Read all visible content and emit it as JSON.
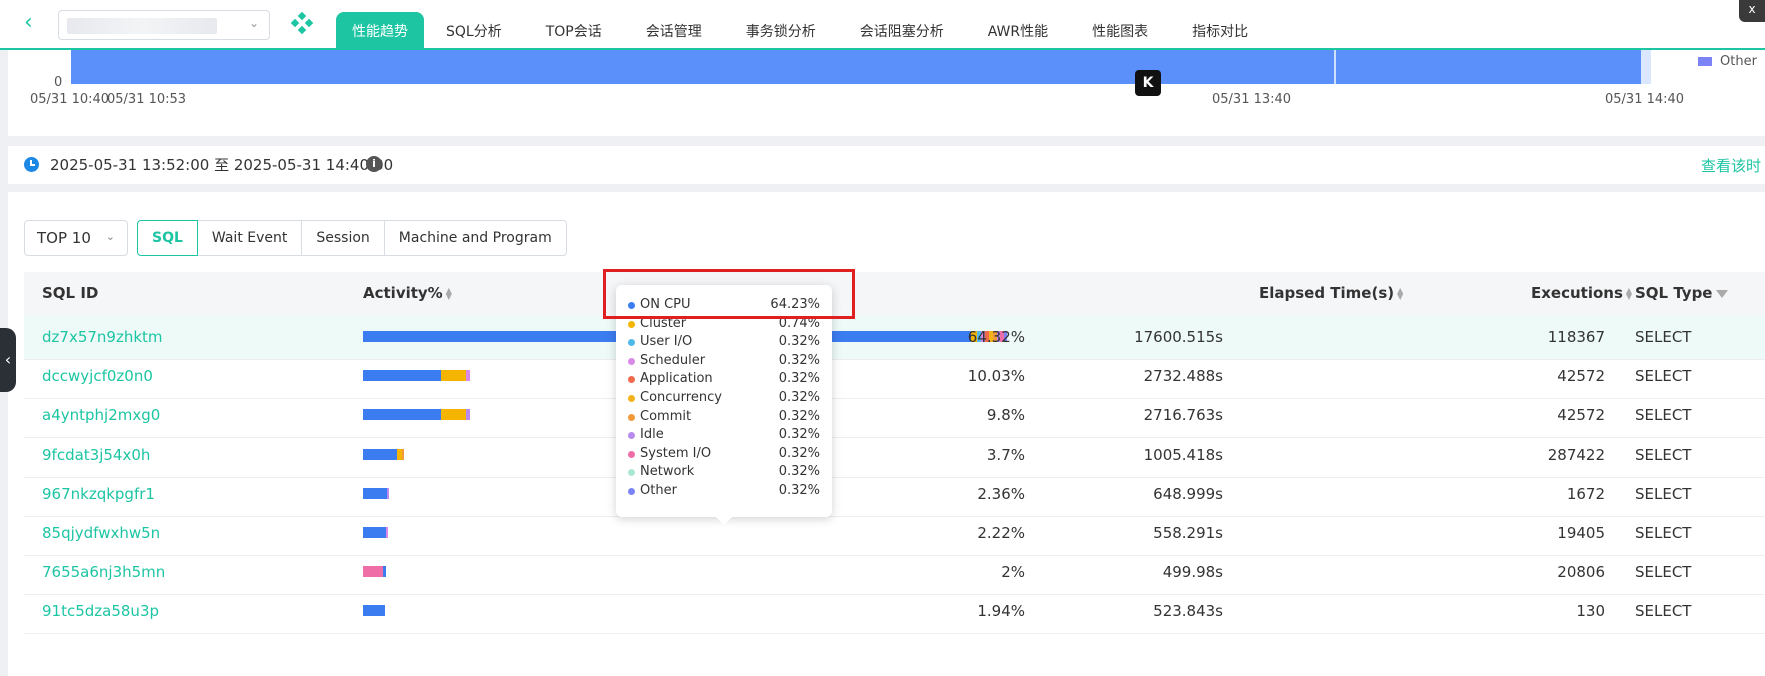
{
  "nav": {
    "tabs": [
      {
        "label": "性能趋势",
        "active": true
      },
      {
        "label": "SQL分析"
      },
      {
        "label": "TOP会话"
      },
      {
        "label": "会话管理"
      },
      {
        "label": "事务锁分析"
      },
      {
        "label": "会话阻塞分析"
      },
      {
        "label": "AWR性能"
      },
      {
        "label": "性能图表"
      },
      {
        "label": "指标对比"
      }
    ],
    "back_icon": "chevron-left-icon",
    "close_label": "x"
  },
  "chart": {
    "y_zero": "0",
    "x_ticks": [
      "05/31 10:40",
      "05/31 10:53",
      "05/31 13:40",
      "05/31 14:40"
    ],
    "legend_other": "Other",
    "legend_other_color": "#7b83f5",
    "bar_color": "#5b8ff9",
    "k_label": "K"
  },
  "time_range": {
    "text": "2025-05-31 13:52:00 至 2025-05-31 14:40:00",
    "info_label": "i",
    "view_link": "查看该时"
  },
  "controls": {
    "top_select": "TOP 10",
    "segments": [
      {
        "label": "SQL",
        "active": true
      },
      {
        "label": "Wait Event"
      },
      {
        "label": "Session"
      },
      {
        "label": "Machine and Program"
      }
    ]
  },
  "table": {
    "headers": {
      "sql_id": "SQL ID",
      "activity": "Activity%",
      "elapsed": "Elapsed Time(s)",
      "executions": "Executions",
      "sql_type": "SQL Type"
    },
    "rows": [
      {
        "sql_id": "dz7x57n9zhktm",
        "activity": "64.32%",
        "elapsed": "17600.515s",
        "executions": "118367",
        "sql_type": "SELECT"
      },
      {
        "sql_id": "dccwyjcf0z0n0",
        "activity": "10.03%",
        "elapsed": "2732.488s",
        "executions": "42572",
        "sql_type": "SELECT"
      },
      {
        "sql_id": "a4yntphj2mxg0",
        "activity": "9.8%",
        "elapsed": "2716.763s",
        "executions": "42572",
        "sql_type": "SELECT"
      },
      {
        "sql_id": "9fcdat3j54x0h",
        "activity": "3.7%",
        "elapsed": "1005.418s",
        "executions": "287422",
        "sql_type": "SELECT"
      },
      {
        "sql_id": "967nkzqkpgfr1",
        "activity": "2.36%",
        "elapsed": "648.999s",
        "executions": "1672",
        "sql_type": "SELECT"
      },
      {
        "sql_id": "85qjydfwxhw5n",
        "activity": "2.22%",
        "elapsed": "558.291s",
        "executions": "19405",
        "sql_type": "SELECT"
      },
      {
        "sql_id": "7655a6nj3h5mn",
        "activity": "2%",
        "elapsed": "499.98s",
        "executions": "20806",
        "sql_type": "SELECT"
      },
      {
        "sql_id": "91tc5dza58u3p",
        "activity": "1.94%",
        "elapsed": "523.843s",
        "executions": "130",
        "sql_type": "SELECT"
      }
    ]
  },
  "tooltip": {
    "items": [
      {
        "name": "ON CPU",
        "value": "64.23%",
        "color": "#3b7cf0"
      },
      {
        "name": "Cluster",
        "value": "0.74%",
        "color": "#f5b400"
      },
      {
        "name": "User I/O",
        "value": "0.32%",
        "color": "#4fb9e8"
      },
      {
        "name": "Scheduler",
        "value": "0.32%",
        "color": "#d98ae8"
      },
      {
        "name": "Application",
        "value": "0.32%",
        "color": "#f06a4b"
      },
      {
        "name": "Concurrency",
        "value": "0.32%",
        "color": "#f2b21a"
      },
      {
        "name": "Commit",
        "value": "0.32%",
        "color": "#f29a3a"
      },
      {
        "name": "Idle",
        "value": "0.32%",
        "color": "#b88af0"
      },
      {
        "name": "System I/O",
        "value": "0.32%",
        "color": "#f06ea8"
      },
      {
        "name": "Network",
        "value": "0.32%",
        "color": "#a8e8d0"
      },
      {
        "name": "Other",
        "value": "0.32%",
        "color": "#7b83f5"
      }
    ]
  }
}
